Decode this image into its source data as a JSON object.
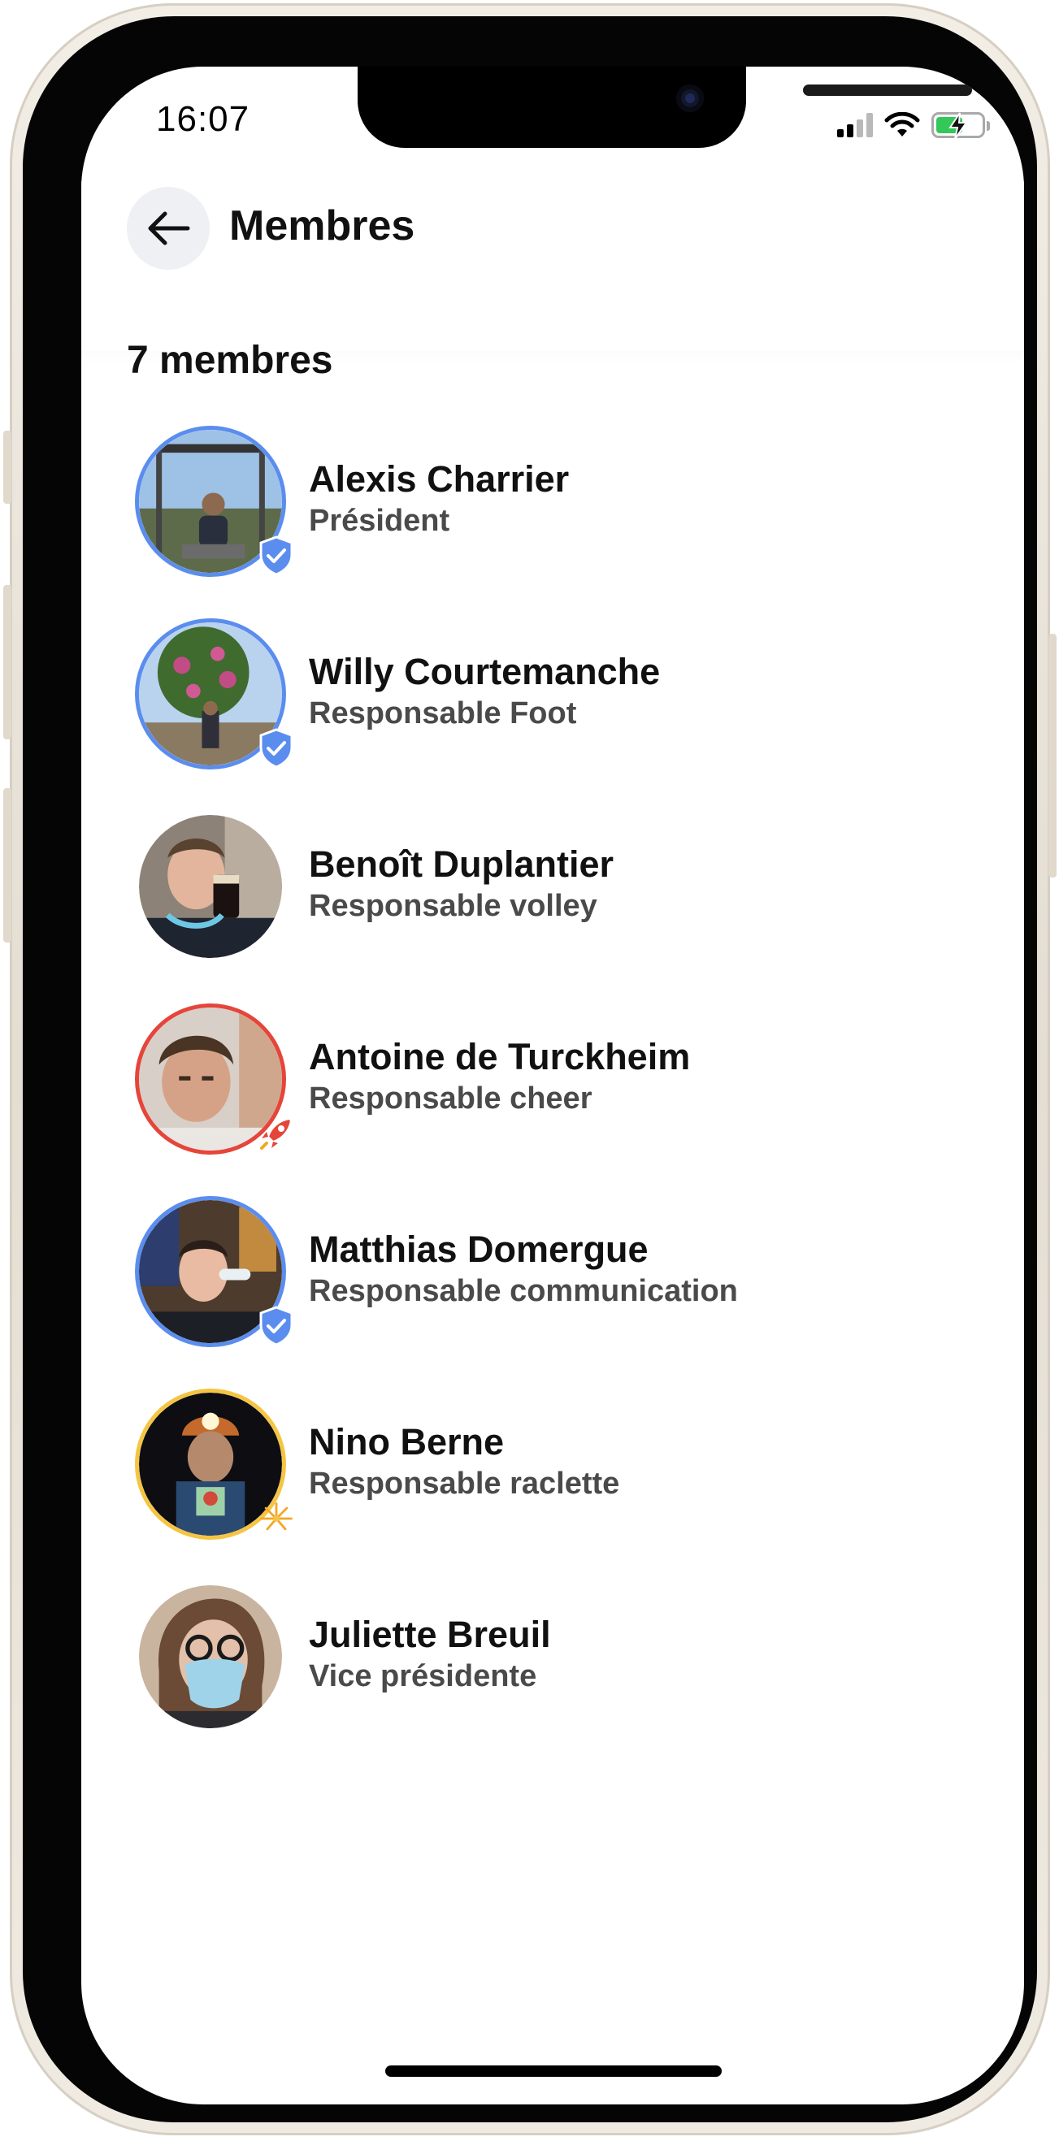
{
  "status_bar": {
    "time": "16:07",
    "signal_icon": "cellular-signal-icon",
    "wifi_icon": "wifi-icon",
    "battery_icon": "battery-charging-icon",
    "battery_color": "#34c759"
  },
  "header": {
    "title": "Membres",
    "back_icon": "arrow-left-icon"
  },
  "members_count": "7 membres",
  "members": [
    {
      "name": "Alexis Charrier",
      "role": "Président",
      "ring_color": "#5b8def",
      "badge": "verified-shield-icon"
    },
    {
      "name": "Willy Courtemanche",
      "role": "Responsable Foot",
      "ring_color": "#5b8def",
      "badge": "verified-shield-icon"
    },
    {
      "name": "Benoît Duplantier",
      "role": "Responsable volley",
      "ring_color": "",
      "badge": ""
    },
    {
      "name": "Antoine de Turckheim",
      "role": "Responsable cheer",
      "ring_color": "#e5453a",
      "badge": "rocket-icon"
    },
    {
      "name": "Matthias Domergue",
      "role": "Responsable communication",
      "ring_color": "#5b8def",
      "badge": "verified-shield-icon"
    },
    {
      "name": "Nino Berne",
      "role": "Responsable raclette",
      "ring_color": "#f5c542",
      "badge": "fireworks-icon"
    },
    {
      "name": "Juliette Breuil",
      "role": "Vice présidente",
      "ring_color": "",
      "badge": ""
    }
  ]
}
